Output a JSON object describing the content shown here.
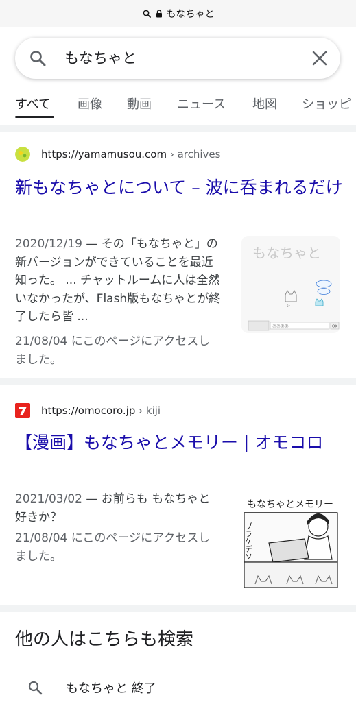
{
  "browser": {
    "url_text": "もなちゃと"
  },
  "search": {
    "query": "もなちゃと"
  },
  "tabs": [
    {
      "label": "すべて"
    },
    {
      "label": "画像"
    },
    {
      "label": "動画"
    },
    {
      "label": "ニュース"
    },
    {
      "label": "地図"
    },
    {
      "label": "ショッピ"
    }
  ],
  "results": [
    {
      "url_domain": "https://yamamusou.com",
      "url_crumb": " › archives",
      "title": "新もなちゃとについて – 波に呑まれるだけ",
      "date": "2020/12/19",
      "snippet": " — その「もなちゃと」の新バージョンができていることを最近知った。 ... チャットルームに人は全然いなかったが、Flash版もなちゃとが終了したら皆 ...",
      "visited": "21/08/04 にこのページにアクセスしました。",
      "thumb_text": "もなちゃと",
      "thumb_input": "ああああ",
      "thumb_ok": "OK"
    },
    {
      "url_domain": "https://omocoro.jp",
      "url_crumb": " › kiji",
      "title": "【漫画】もなちゃとメモリー | オモコロ",
      "date": "2021/03/02",
      "snippet": " — お前らも もなちゃと 好きか？",
      "visited": "21/08/04 にこのページにアクセスしました。",
      "thumb_text": "もなちゃとメモリー",
      "thumb_side": "ブラケデソ"
    }
  ],
  "related": {
    "title": "他の人はこちらも検索",
    "items": [
      {
        "label": "もなちゃと 終了"
      }
    ]
  },
  "colors": {
    "link": "#1a0dab",
    "muted": "#5f6368",
    "omocoro_red": "#e8231e"
  }
}
